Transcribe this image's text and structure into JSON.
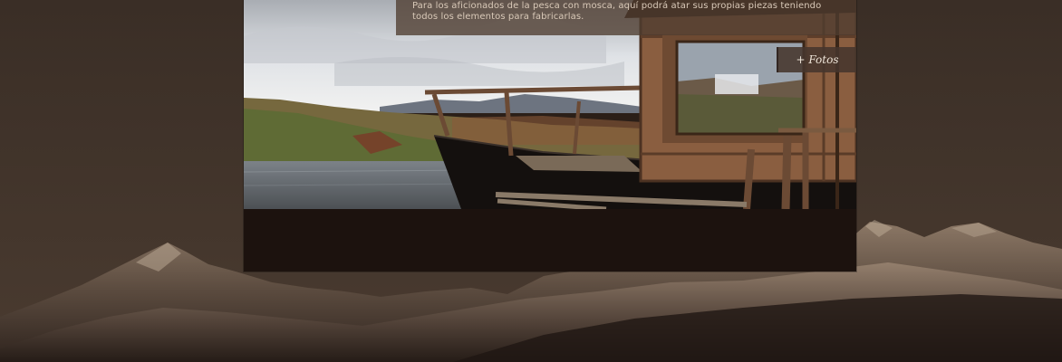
{
  "caption": {
    "line1": "Para los aficionados de la pesca con mosca, aquí podrá atar sus propias piezas teniendo",
    "line2": "todos los elementos para fabricarlas."
  },
  "gallery": {
    "fotos_label": "+ Fotos"
  },
  "images": {
    "background": "mountain-landscape-sepia",
    "photo": "wooden-boat-on-river"
  },
  "colors": {
    "background": "#3b2f27",
    "panel": "#1c120e",
    "caption_bg": "#4e3c30",
    "caption_text": "#d9c9b8"
  }
}
